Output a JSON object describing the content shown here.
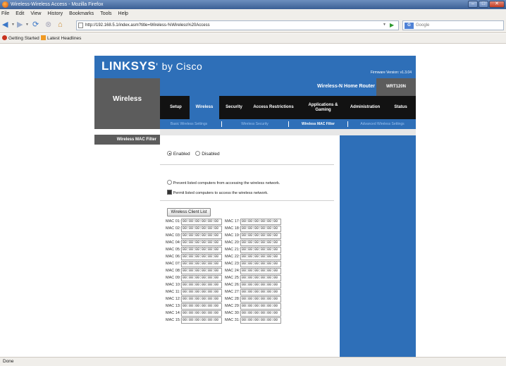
{
  "browser": {
    "window_title": "Wireless-Wireless Access - Mozilla Firefox",
    "menu": [
      "File",
      "Edit",
      "View",
      "History",
      "Bookmarks",
      "Tools",
      "Help"
    ],
    "url": "http://192.168.5.1/index.asm?title=Wireless-%Wireless%20Access",
    "search_placeholder": "Google",
    "search_engine": "G",
    "bookmarks": [
      "Getting Started",
      "Latest Headlines"
    ],
    "status": "Done"
  },
  "router": {
    "brand": "LINKSYS",
    "brand_suffix": "by Cisco",
    "firmware": "Firmware Version: v1.3.04",
    "section": "Wireless",
    "product_name": "Wireless-N Home Router",
    "model": "WRT120N",
    "tabs": [
      "Setup",
      "Wireless",
      "Security",
      "Access Restrictions",
      "Applications & Gaming",
      "Administration",
      "Status"
    ],
    "active_tab": "Wireless",
    "subtabs": [
      "Basic Wireless Settings",
      "Wireless Security",
      "Wireless MAC Filter",
      "Advanced Wireless Settings"
    ],
    "active_subtab": "Wireless MAC Filter",
    "sidebar_label": "Wireless MAC Filter",
    "enable_options": [
      "Enabled",
      "Disabled"
    ],
    "enable_selected": "Enabled",
    "prevent_label": "Prevent listed computers from accessing the wireless network.",
    "permit_label": "Permit listed computers to access the wireless network.",
    "permit_selected": true,
    "client_list_button": "Wireless Client List",
    "mac_left": [
      {
        "label": "MAC 01:",
        "value": "00:00:00:00:00:00"
      },
      {
        "label": "MAC 02:",
        "value": "00:00:00:00:00:00"
      },
      {
        "label": "MAC 03:",
        "value": "00:00:00:00:00:00"
      },
      {
        "label": "MAC 04:",
        "value": "00:00:00:00:00:00"
      },
      {
        "label": "MAC 05:",
        "value": "00:00:00:00:00:00"
      },
      {
        "label": "MAC 06:",
        "value": "00:00:00:00:00:00"
      },
      {
        "label": "MAC 07:",
        "value": "00:00:00:00:00:00"
      },
      {
        "label": "MAC 08:",
        "value": "00:00:00:00:00:00"
      },
      {
        "label": "MAC 09:",
        "value": "00:00:00:00:00:00"
      },
      {
        "label": "MAC 10:",
        "value": "00:00:00:00:00:00"
      },
      {
        "label": "MAC 11:",
        "value": "00:00:00:00:00:00"
      },
      {
        "label": "MAC 12:",
        "value": "00:00:00:00:00:00"
      },
      {
        "label": "MAC 13:",
        "value": "00:00:00:00:00:00"
      },
      {
        "label": "MAC 14:",
        "value": "00:00:00:00:00:00"
      },
      {
        "label": "MAC 15:",
        "value": "00:00:00:00:00:00"
      }
    ],
    "mac_right": [
      {
        "label": "MAC 17:",
        "value": "00:00:00:00:00:00"
      },
      {
        "label": "MAC 18:",
        "value": "00:00:00:00:00:00"
      },
      {
        "label": "MAC 19:",
        "value": "00:00:00:00:00:00"
      },
      {
        "label": "MAC 20:",
        "value": "00:00:00:00:00:00"
      },
      {
        "label": "MAC 21:",
        "value": "00:00:00:00:00:00"
      },
      {
        "label": "MAC 22:",
        "value": "00:00:00:00:00:00"
      },
      {
        "label": "MAC 23:",
        "value": "00:00:00:00:00:00"
      },
      {
        "label": "MAC 24:",
        "value": "00:00:00:00:00:00"
      },
      {
        "label": "MAC 25:",
        "value": "00:00:00:00:00:00"
      },
      {
        "label": "MAC 26:",
        "value": "00:00:00:00:00:00"
      },
      {
        "label": "MAC 27:",
        "value": "00:00:00:00:00:00"
      },
      {
        "label": "MAC 28:",
        "value": "00:00:00:00:00:00"
      },
      {
        "label": "MAC 29:",
        "value": "00:00:00:00:00:00"
      },
      {
        "label": "MAC 30:",
        "value": "00:00:00:00:00:00"
      },
      {
        "label": "MAC 31:",
        "value": "00:00:00:00:00:00"
      }
    ]
  },
  "colors": {
    "linksys_blue": "#2e6fb8",
    "tab_bar": "#121212",
    "dark_gray": "#5c5c5c"
  }
}
